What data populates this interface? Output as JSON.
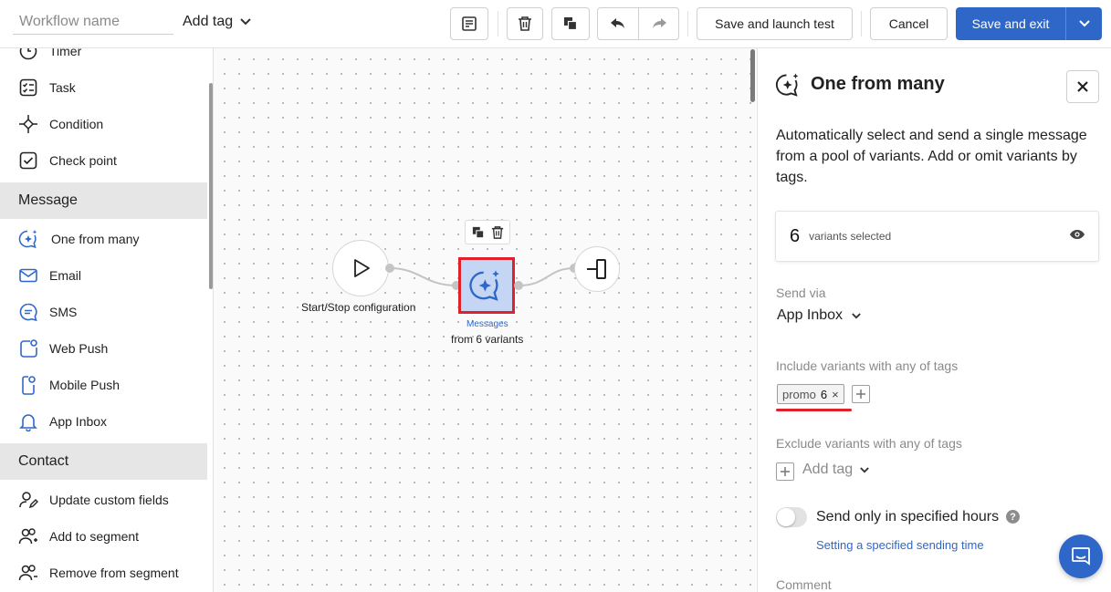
{
  "topbar": {
    "workflow_name_placeholder": "Workflow name",
    "add_tag_label": "Add tag",
    "save_launch_label": "Save and launch test",
    "cancel_label": "Cancel",
    "save_exit_label": "Save and exit"
  },
  "palette": {
    "items": [
      {
        "label": "Timer",
        "icon": "clock-icon"
      },
      {
        "label": "Task",
        "icon": "checklist-icon"
      },
      {
        "label": "Condition",
        "icon": "condition-icon"
      },
      {
        "label": "Check point",
        "icon": "checkbox-icon"
      },
      {
        "label": "One from many",
        "icon": "sparkle-chat-icon"
      },
      {
        "label": "Email",
        "icon": "envelope-icon"
      },
      {
        "label": "SMS",
        "icon": "message-bubble-icon"
      },
      {
        "label": "Web Push",
        "icon": "web-push-icon"
      },
      {
        "label": "Mobile Push",
        "icon": "mobile-push-icon"
      },
      {
        "label": "App Inbox",
        "icon": "bell-icon"
      },
      {
        "label": "Update custom fields",
        "icon": "user-edit-icon"
      },
      {
        "label": "Add to segment",
        "icon": "users-add-icon"
      },
      {
        "label": "Remove from segment",
        "icon": "users-remove-icon"
      }
    ],
    "sections": {
      "message": "Message",
      "contact": "Contact"
    }
  },
  "canvas": {
    "start_label": "Start/Stop configuration",
    "message_node_title": "Messages",
    "message_node_subtitle": "from 6 variants"
  },
  "panel": {
    "title": "One from many",
    "description": "Automatically select and send a single message from a pool of variants. Add or omit variants by tags.",
    "variants_count": "6",
    "variants_text": "variants selected",
    "send_via_label": "Send via",
    "send_via_value": "App Inbox",
    "include_label": "Include variants with any of tags",
    "include_tag": {
      "name": "promo",
      "count": "6",
      "remove": "×"
    },
    "exclude_label": "Exclude variants with any of tags",
    "add_tag_label": "Add tag",
    "hours_label": "Send only in specified hours",
    "hours_link": "Setting a specified sending time",
    "comment_label": "Comment"
  },
  "colors": {
    "accent": "#2f67c9",
    "highlight": "#e0202a",
    "node_fill": "#c5d6f4"
  }
}
